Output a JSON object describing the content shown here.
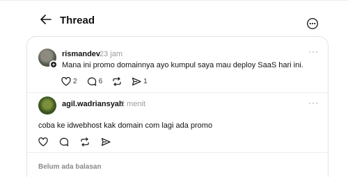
{
  "header": {
    "title": "Thread",
    "back_icon": "arrow-left-icon",
    "menu_icon": "more-circle-icon"
  },
  "thread": {
    "root_post": {
      "username": "rismandev",
      "time": "23 jam",
      "text": "Mana ini promo domainnya ayo kumpul saya mau deploy SaaS hari ini.",
      "likes": "2",
      "comments": "6",
      "shares": "1"
    },
    "reply": {
      "username": "agil.wadriansyah",
      "time": "2 menit",
      "text": "coba ke idwebhost kak domain com lagi ada promo"
    },
    "replies_status": "Belum ada balasan"
  }
}
